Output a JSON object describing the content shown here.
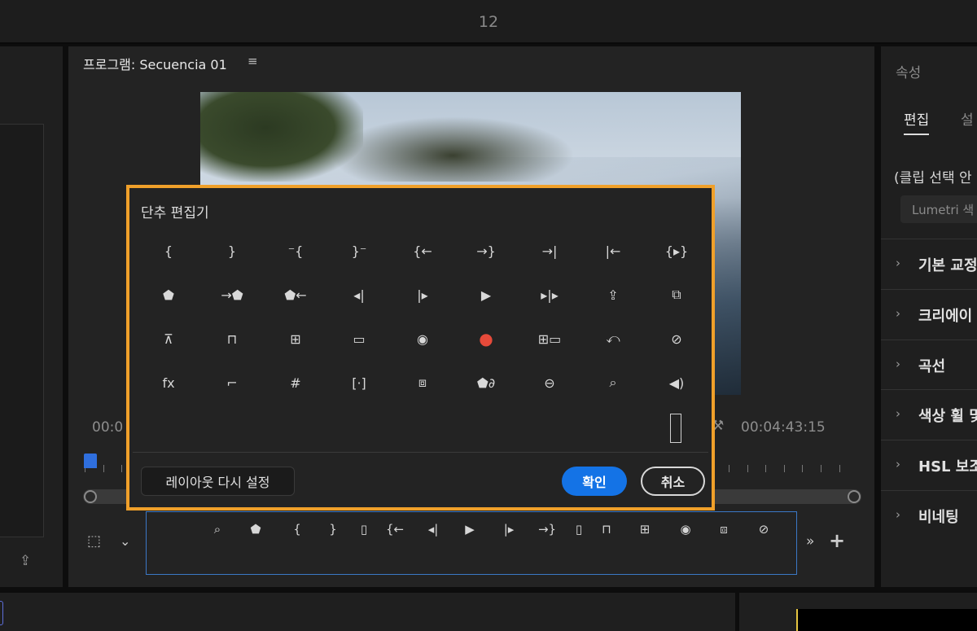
{
  "topbar": {
    "title": "12"
  },
  "program": {
    "title": "프로그램: Secuencia 01",
    "menu_icon": "hamburger-icon",
    "timecode_left": "00:0",
    "timecode_right": "00:04:43:15"
  },
  "editor": {
    "title": "단추 편집기",
    "rows": [
      [
        {
          "name": "mark-in-icon",
          "glyph": "{"
        },
        {
          "name": "mark-out-icon",
          "glyph": "}"
        },
        {
          "name": "go-to-in-icon",
          "glyph": "⁻{"
        },
        {
          "name": "go-to-out-icon",
          "glyph": "}⁻"
        },
        {
          "name": "go-to-prev-edit-icon",
          "glyph": "{←"
        },
        {
          "name": "go-to-next-edit-icon",
          "glyph": "→}"
        },
        {
          "name": "go-to-end-icon",
          "glyph": "→|"
        },
        {
          "name": "go-to-start-icon",
          "glyph": "|←"
        },
        {
          "name": "play-in-to-out-icon",
          "glyph": "{▸}"
        }
      ],
      [
        {
          "name": "add-marker-icon",
          "glyph": "⬟"
        },
        {
          "name": "go-to-next-marker-icon",
          "glyph": "→⬟"
        },
        {
          "name": "go-to-prev-marker-icon",
          "glyph": "⬟←"
        },
        {
          "name": "step-back-icon",
          "glyph": "◂|"
        },
        {
          "name": "step-forward-icon",
          "glyph": "|▸"
        },
        {
          "name": "play-icon",
          "glyph": "▶"
        },
        {
          "name": "play-around-icon",
          "glyph": "▸|▸"
        },
        {
          "name": "export-frame-up-icon",
          "glyph": "⇪"
        },
        {
          "name": "overwrite-icon",
          "glyph": "⧉"
        }
      ],
      [
        {
          "name": "lift-icon",
          "glyph": "⊼"
        },
        {
          "name": "extract-icon",
          "glyph": "⊓"
        },
        {
          "name": "insert-icon",
          "glyph": "⊞"
        },
        {
          "name": "safe-margins-icon",
          "glyph": "▭"
        },
        {
          "name": "camera-icon",
          "glyph": "◉"
        },
        {
          "name": "record-icon",
          "glyph": "●",
          "rec": true
        },
        {
          "name": "multicam-icon",
          "glyph": "⊞▭"
        },
        {
          "name": "undo-icon",
          "glyph": "⤺"
        },
        {
          "name": "comparison-view-icon",
          "glyph": "⊘"
        }
      ],
      [
        {
          "name": "fx-icon",
          "glyph": "fx"
        },
        {
          "name": "film-strip-icon",
          "glyph": "⌐"
        },
        {
          "name": "grid-icon",
          "glyph": "#"
        },
        {
          "name": "trim-icon",
          "glyph": "[·]"
        },
        {
          "name": "toggle-proxies-icon",
          "glyph": "⧈"
        },
        {
          "name": "link-marker-icon",
          "glyph": "⬟∂"
        },
        {
          "name": "vr-video-icon",
          "glyph": "⊖"
        },
        {
          "name": "zoom-clip-icon",
          "glyph": "⌕"
        },
        {
          "name": "volume-icon",
          "glyph": "◀)"
        }
      ]
    ],
    "reset_label": "레이아웃 다시 설정",
    "ok_label": "확인",
    "cancel_label": "취소"
  },
  "transport": [
    {
      "name": "zoom-clip-icon",
      "glyph": "⌕"
    },
    {
      "name": "add-marker-icon",
      "glyph": "⬟"
    },
    {
      "name": "mark-in-icon",
      "glyph": "{"
    },
    {
      "name": "mark-out-icon",
      "glyph": "}"
    },
    {
      "name": "spacer-icon",
      "glyph": "▯"
    },
    {
      "name": "go-to-prev-edit-icon",
      "glyph": "{←"
    },
    {
      "name": "step-back-icon",
      "glyph": "◂|"
    },
    {
      "name": "play-icon",
      "glyph": "▶"
    },
    {
      "name": "step-forward-icon",
      "glyph": "|▸"
    },
    {
      "name": "go-to-next-edit-icon",
      "glyph": "→}"
    },
    {
      "name": "spacer-icon",
      "glyph": "▯"
    },
    {
      "name": "lift-icon",
      "glyph": "⊓"
    },
    {
      "name": "extract-icon",
      "glyph": "⊞"
    },
    {
      "name": "camera-icon",
      "glyph": "◉"
    },
    {
      "name": "toggle-proxies-icon",
      "glyph": "⧈"
    },
    {
      "name": "comparison-view-icon",
      "glyph": "⊘"
    }
  ],
  "right_panel": {
    "tab": "속성",
    "tab2": "",
    "edit_tab": "편집",
    "settings_tab": "설",
    "clip_text": "(클립 선택 안",
    "lumetri": "Lumetri 색",
    "sections": [
      "기본 교정",
      "크리에이",
      "곡선",
      "색상 휠 및",
      "HSL 보조",
      "비네팅"
    ]
  },
  "colors": {
    "accent_border": "#f0a02a",
    "primary_button": "#1473e6",
    "record": "#e64a3a"
  }
}
